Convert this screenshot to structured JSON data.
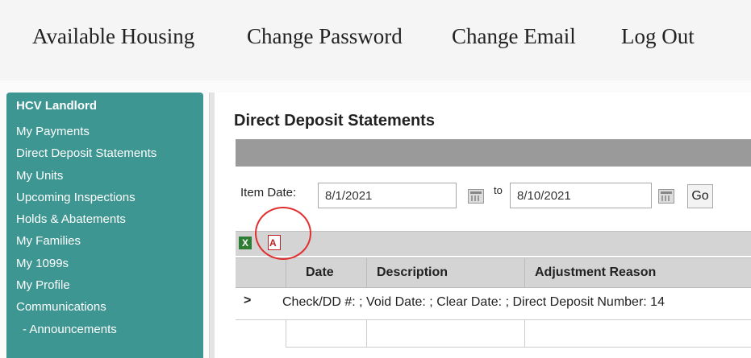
{
  "topnav": {
    "items": [
      {
        "label": "Available Housing"
      },
      {
        "label": "Change Password"
      },
      {
        "label": "Change Email"
      },
      {
        "label": "Log Out"
      }
    ]
  },
  "sidebar": {
    "title": "HCV Landlord",
    "items": [
      {
        "label": "My Payments"
      },
      {
        "label": "Direct Deposit Statements"
      },
      {
        "label": "My Units"
      },
      {
        "label": "Upcoming Inspections"
      },
      {
        "label": "Holds & Abatements"
      },
      {
        "label": "My Families"
      },
      {
        "label": "My 1099s"
      },
      {
        "label": "My Profile"
      },
      {
        "label": "Communications"
      },
      {
        "label": "- Announcements"
      }
    ]
  },
  "main": {
    "title": "Direct Deposit Statements",
    "filter": {
      "item_date_label": "Item Date:",
      "from_value": "8/1/2021",
      "to_label": "to",
      "to_value": "8/10/2021",
      "go_label": "Go"
    },
    "export": {
      "excel_icon": "excel-icon",
      "pdf_icon": "pdf-icon",
      "excel_glyph": "X",
      "pdf_glyph": "A"
    },
    "grid": {
      "columns": [
        "Date",
        "Description",
        "Adjustment Reason"
      ],
      "expand_glyph": ">",
      "row_text": "Check/DD #: ; Void Date: ; Clear Date: ; Direct Deposit Number: 14"
    }
  },
  "colors": {
    "sidebar": "#3d9692",
    "annotation_circle": "#e03030"
  }
}
